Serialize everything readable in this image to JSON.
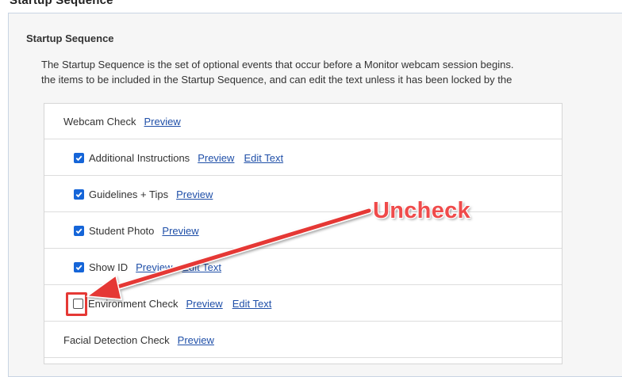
{
  "page_header_fragment": "Startup Sequence",
  "section": {
    "title": "Startup Sequence",
    "description_line1": "The Startup Sequence is the set of optional events that occur before a Monitor webcam session begins.",
    "description_line2": "the items to be included in the Startup Sequence, and can edit the text unless it has been locked by the"
  },
  "rows": [
    {
      "label": "Webcam Check",
      "checkbox": "none",
      "preview": "Preview",
      "edit": ""
    },
    {
      "label": "Additional Instructions",
      "checkbox": "checked",
      "preview": "Preview",
      "edit": "Edit Text"
    },
    {
      "label": "Guidelines + Tips",
      "checkbox": "checked",
      "preview": "Preview",
      "edit": ""
    },
    {
      "label": "Student Photo",
      "checkbox": "checked",
      "preview": "Preview",
      "edit": ""
    },
    {
      "label": "Show ID",
      "checkbox": "checked",
      "preview": "Preview",
      "edit": "Edit Text"
    },
    {
      "label": "Environment Check",
      "checkbox": "unchecked",
      "preview": "Preview",
      "edit": "Edit Text"
    },
    {
      "label": "Facial Detection Check",
      "checkbox": "none",
      "preview": "Preview",
      "edit": ""
    }
  ],
  "annotation": {
    "callout_text": "Uncheck",
    "color": "#e53935"
  },
  "colors": {
    "checkbox_checked": "#1565d8",
    "link": "#1f4fa8",
    "panel_bg": "#f6f6f6"
  }
}
